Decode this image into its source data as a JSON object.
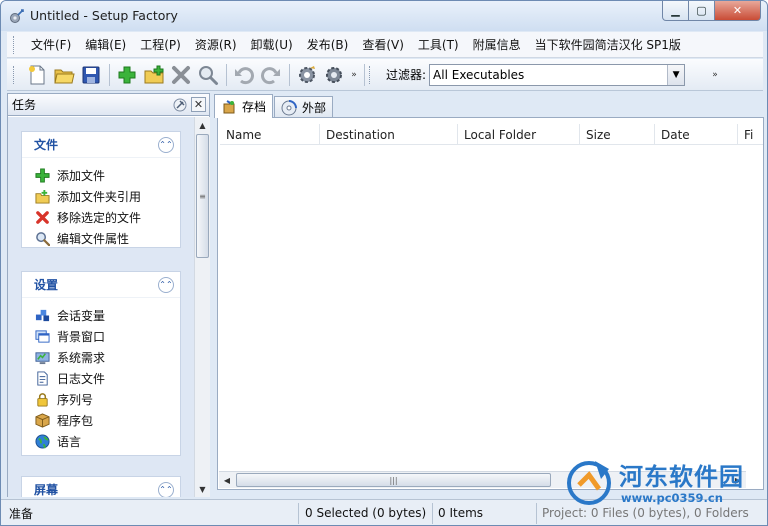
{
  "window": {
    "title": "Untitled - Setup Factory",
    "min_glyph": "▁",
    "max_glyph": "▢",
    "close_glyph": "✕"
  },
  "menu": {
    "items": [
      "文件(F)",
      "编辑(E)",
      "工程(P)",
      "资源(R)",
      "卸载(U)",
      "发布(B)",
      "查看(V)",
      "工具(T)",
      "附属信息",
      "当下软件园简洁汉化 SP1版"
    ]
  },
  "toolbar": {
    "buttons": [
      "new-file-icon",
      "open-folder-icon",
      "save-icon",
      "add-green-plus-icon",
      "add-folder-reference-icon",
      "remove-x-icon",
      "search-properties-icon",
      "undo-icon",
      "redo-icon",
      "build-gear-icon",
      "settings-gear-icon"
    ],
    "filter_label": "过滤器:",
    "filter_value": "All Executables",
    "more_glyph": "»"
  },
  "left_pane": {
    "title": "任务",
    "groups": [
      {
        "title": "文件",
        "items": [
          {
            "label": "添加文件",
            "icon": "green-plus-icon"
          },
          {
            "label": "添加文件夹引用",
            "icon": "folder-plus-icon"
          },
          {
            "label": "移除选定的文件",
            "icon": "red-x-icon"
          },
          {
            "label": "编辑文件属性",
            "icon": "magnifier-icon"
          }
        ]
      },
      {
        "title": "设置",
        "items": [
          {
            "label": "会话变量",
            "icon": "session-variables-icon"
          },
          {
            "label": "背景窗口",
            "icon": "background-window-icon"
          },
          {
            "label": "系统需求",
            "icon": "system-requirements-icon"
          },
          {
            "label": "日志文件",
            "icon": "log-file-icon"
          },
          {
            "label": "序列号",
            "icon": "lock-icon"
          },
          {
            "label": "程序包",
            "icon": "package-icon"
          },
          {
            "label": "语言",
            "icon": "globe-icon"
          }
        ]
      },
      {
        "title": "屏幕",
        "items": []
      }
    ]
  },
  "tabs": [
    {
      "label": "存档",
      "active": true
    },
    {
      "label": "外部",
      "active": false
    }
  ],
  "list": {
    "columns": [
      "Name",
      "Destination",
      "Local Folder",
      "Size",
      "Date",
      "Fi"
    ]
  },
  "status": {
    "ready": "准备",
    "selected": "0 Selected (0 bytes)",
    "items": "0 Items",
    "project": "Project: 0 Files (0 bytes), 0 Folders"
  },
  "watermark": {
    "brand": "河东软件园",
    "url": "www.pc0359.cn"
  },
  "colors": {
    "accent": "#2152a3",
    "title_bar": "#cfdef1",
    "task_area": "#dee7f4",
    "watermark": "#2a78c8"
  }
}
